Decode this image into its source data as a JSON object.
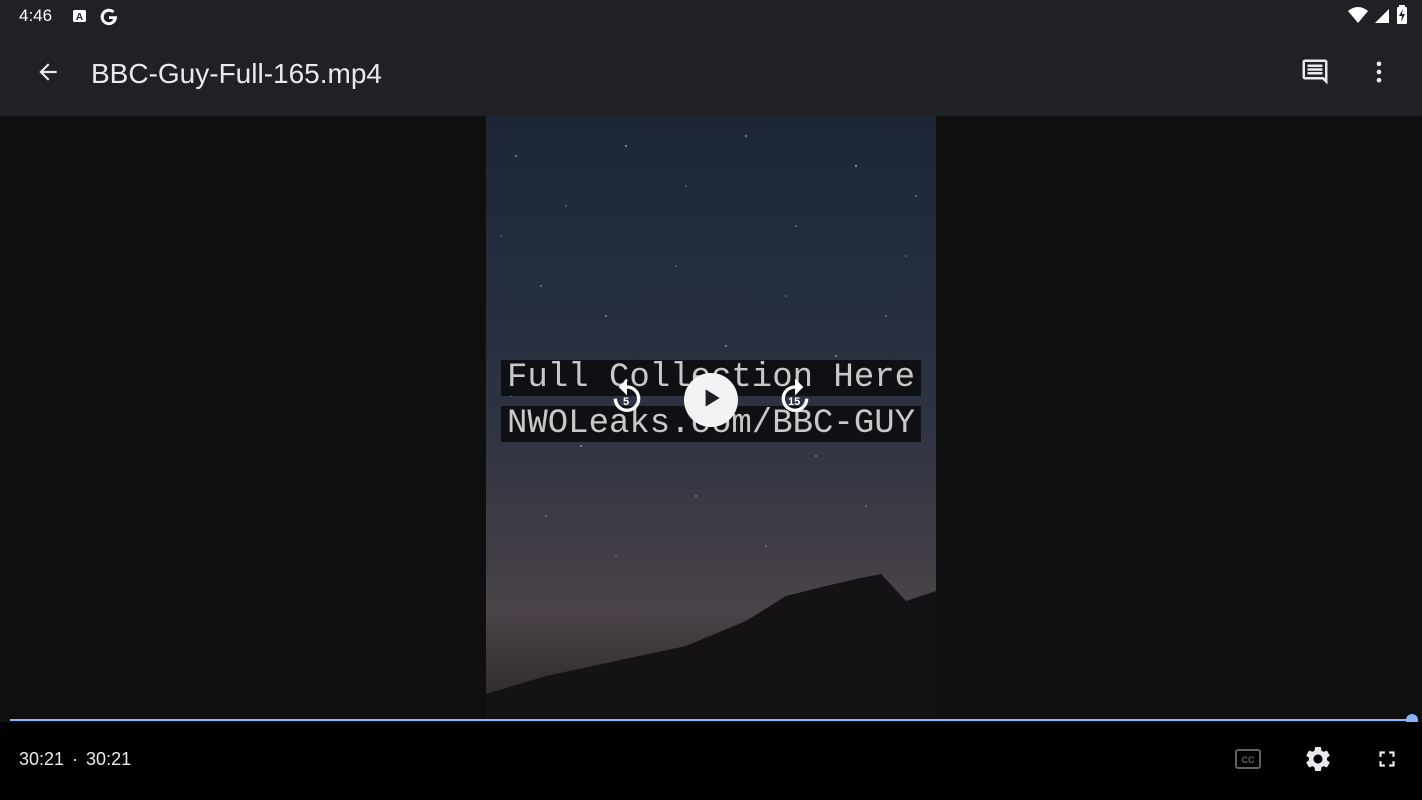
{
  "status_bar": {
    "time": "4:46",
    "left_icons": [
      "font-a-icon",
      "google-g-icon"
    ],
    "right_icons": [
      "wifi-icon",
      "signal-icon",
      "battery-charging-icon"
    ]
  },
  "app_bar": {
    "title": "BBC-Guy-Full-165.mp4",
    "icons": [
      "back-arrow-icon",
      "comment-icon",
      "more-vert-icon"
    ]
  },
  "video": {
    "overlay_line1": "Full Collection Here",
    "overlay_line2": "NWOLeaks.com/BBC-GUY",
    "rewind_seconds": "5",
    "forward_seconds": "15"
  },
  "playback": {
    "position": "30:21",
    "separator": "·",
    "duration": "30:21",
    "progress_fraction": 1.0
  },
  "bottom_controls": {
    "icons": [
      "closed-captions-icon",
      "settings-gear-icon",
      "fullscreen-icon"
    ]
  },
  "colors": {
    "accent": "#8ab4f8",
    "bar_background": "#202125"
  }
}
